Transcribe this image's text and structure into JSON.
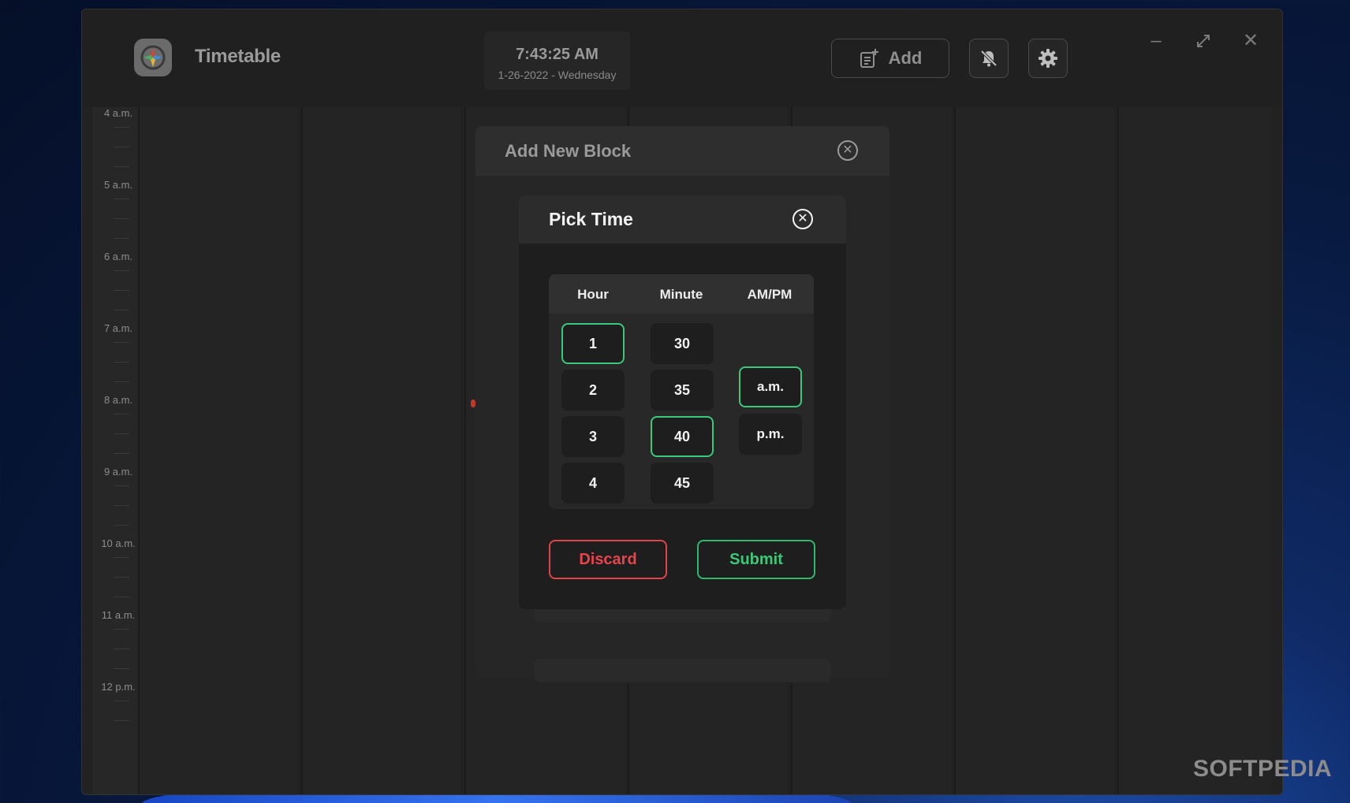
{
  "app": {
    "title": "Timetable"
  },
  "clock": {
    "time": "7:43:25 AM",
    "date": "1-26-2022 - Wednesday"
  },
  "toolbar": {
    "add_label": "Add"
  },
  "timeline": {
    "labels": [
      "4 a.m.",
      "5 a.m.",
      "6 a.m.",
      "7 a.m.",
      "8 a.m.",
      "9 a.m.",
      "10 a.m.",
      "11 a.m.",
      "12 p.m."
    ]
  },
  "add_block": {
    "title": "Add New Block"
  },
  "pick_time": {
    "title": "Pick Time",
    "headers": {
      "hour": "Hour",
      "minute": "Minute",
      "ampm": "AM/PM"
    },
    "hours": [
      "1",
      "2",
      "3",
      "4"
    ],
    "minutes": [
      "30",
      "35",
      "40",
      "45"
    ],
    "periods": [
      "a.m.",
      "p.m."
    ],
    "selected": {
      "hour": "1",
      "minute": "40",
      "period": "a.m."
    },
    "discard_label": "Discard",
    "submit_label": "Submit"
  },
  "colors": {
    "accent_green": "#39c97a",
    "danger_red": "#e0434a"
  },
  "watermark": "SOFTPEDIA"
}
